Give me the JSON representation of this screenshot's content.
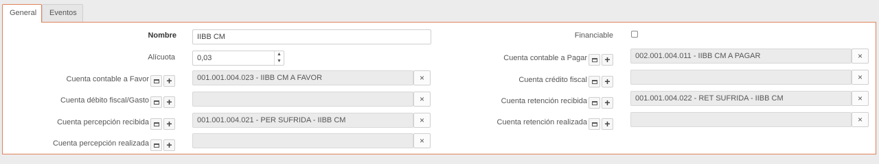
{
  "tabs": [
    {
      "label": "General",
      "active": true
    },
    {
      "label": "Eventos",
      "active": false
    }
  ],
  "form": {
    "nombre": {
      "label": "Nombre",
      "value": "IIBB CM"
    },
    "alicuota": {
      "label": "Alícuota",
      "value": "0,03"
    },
    "cuenta_favor": {
      "label": "Cuenta contable a Favor",
      "value": "001.001.004.023 - IIBB CM A FAVOR"
    },
    "cuenta_debito": {
      "label": "Cuenta débito fiscal/Gasto",
      "value": ""
    },
    "cuenta_percepcion_recibida": {
      "label": "Cuenta percepción recibida",
      "value": "001.001.004.021 - PER SUFRIDA - IIBB CM"
    },
    "cuenta_percepcion_realizada": {
      "label": "Cuenta percepción realizada",
      "value": ""
    },
    "financiable": {
      "label": "Financiable",
      "checked": false
    },
    "cuenta_pagar": {
      "label": "Cuenta contable a Pagar",
      "value": "002.001.004.011 - IIBB CM A PAGAR"
    },
    "cuenta_credito": {
      "label": "Cuenta crédito fiscal",
      "value": ""
    },
    "cuenta_retencion_recibida": {
      "label": "Cuenta retención recibida",
      "value": "001.001.004.022 - RET SUFRIDA - IIBB CM"
    },
    "cuenta_retencion_realizada": {
      "label": "Cuenta retención realizada",
      "value": ""
    }
  },
  "icons": {
    "clear": "×",
    "add": "+",
    "spin_up": "▲",
    "spin_down": "▼"
  }
}
